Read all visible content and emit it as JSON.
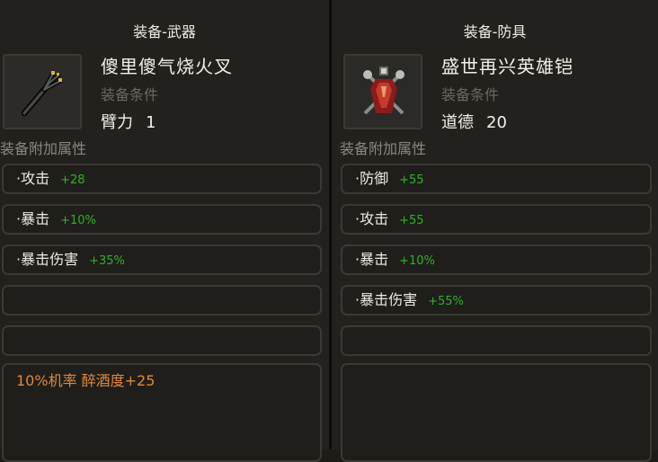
{
  "left": {
    "title": "装备-武器",
    "item_name": "傻里傻气烧火叉",
    "requirement_label": "装备条件",
    "requirement": {
      "stat": "臂力",
      "value": "1"
    },
    "section_label": "装备附加属性",
    "stats": [
      {
        "name": "·攻击",
        "value": "+28"
      },
      {
        "name": "·暴击",
        "value": "+10%"
      },
      {
        "name": "·暴击伤害",
        "value": "+35%"
      }
    ],
    "special": "10%机率 醉酒度+25"
  },
  "right": {
    "title": "装备-防具",
    "item_name": "盛世再兴英雄铠",
    "requirement_label": "装备条件",
    "requirement": {
      "stat": "道德",
      "value": "20"
    },
    "section_label": "装备附加属性",
    "stats": [
      {
        "name": "·防御",
        "value": "+55"
      },
      {
        "name": "·攻击",
        "value": "+55"
      },
      {
        "name": "·暴击",
        "value": "+10%"
      },
      {
        "name": "·暴击伤害",
        "value": "+55%"
      }
    ]
  },
  "colors": {
    "stat_bonus": "#2fb22a",
    "special_effect": "#e0883d",
    "muted_label": "#6b6a63"
  },
  "icons": {
    "weapon": "fire-poker-icon",
    "armor": "armor-icon"
  }
}
